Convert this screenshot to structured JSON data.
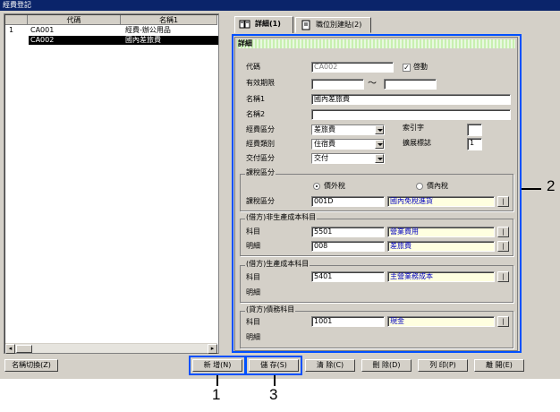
{
  "window": {
    "title": "經費登記"
  },
  "list": {
    "columns": [
      "代碼",
      "名稱1"
    ],
    "rows": [
      {
        "index": "1",
        "code": "CA001",
        "name": "經費-辦公用品"
      },
      {
        "index": "",
        "code": "CA002",
        "name": "國內差旅費"
      }
    ]
  },
  "tabs": [
    {
      "label": "詳細(1)"
    },
    {
      "label": "職位別建貼(2)"
    }
  ],
  "detail": {
    "header": "詳細",
    "code_label": "代碼",
    "code_value": "CA002",
    "enabled_label": "啓動",
    "enabled_mark": "✓",
    "period_label": "有效期限",
    "period_sep": "～",
    "name1_label": "名稱1",
    "name1_value": "國內差旅費",
    "name2_label": "名稱2",
    "name2_value": "",
    "expense_cat_label": "經費區分",
    "expense_cat_value": "差旅費",
    "index_char_label": "索引字",
    "index_char_value": "",
    "expense_type_label": "經費類別",
    "expense_type_value": "住宿費",
    "ext_mark_label": "擴展標誌",
    "ext_mark_value": "1",
    "payment_label": "交付區分",
    "payment_value": "交付",
    "tax_group_title": "課稅區分",
    "tax_radio1": "價外稅",
    "tax_radio2": "價內稅",
    "tax_code_label": "課稅區分",
    "tax_code_value": "001D",
    "tax_code_desc": "國內免稅進貨",
    "debit_nonprod_title": "(借方)非生產成本科目",
    "debit_nonprod_account_label": "科目",
    "debit_nonprod_account_value": "5501",
    "debit_nonprod_account_desc": "營業費用",
    "debit_nonprod_detail_label": "明細",
    "debit_nonprod_detail_value": "008",
    "debit_nonprod_detail_desc": "差旅費",
    "debit_prod_title": "(借方)生產成本科目",
    "debit_prod_account_label": "科目",
    "debit_prod_account_value": "5401",
    "debit_prod_account_desc": "主營業務成本",
    "debit_prod_detail_label": "明細",
    "credit_title": "(貸方)債務科目",
    "credit_account_label": "科目",
    "credit_account_value": "1001",
    "credit_account_desc": "現金",
    "credit_detail_label": "明細",
    "lookup_glyph": "|"
  },
  "buttons": {
    "name_switch": "名稱切換(Z)",
    "new": "新 增(N)",
    "save": "儲 存(S)",
    "clear": "清 除(C)",
    "delete": "刪 除(D)",
    "print": "列 印(P)",
    "close": "離 開(E)"
  },
  "callouts": {
    "c1": "1",
    "c2": "2",
    "c3": "3"
  },
  "colors": {
    "highlight": "#0050ff",
    "titlebar": "#0a246a",
    "face": "#d4d0c8"
  }
}
